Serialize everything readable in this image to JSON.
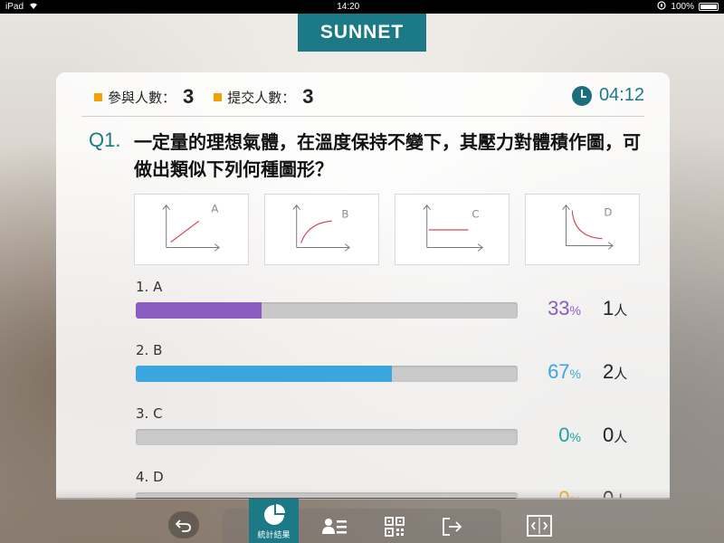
{
  "status_bar": {
    "device": "iPad",
    "time": "14:20",
    "battery": "100%"
  },
  "logo": {
    "text": "SUNNET"
  },
  "header": {
    "participants_label": "參與人數：",
    "participants_value": "3",
    "submitted_label": "提交人數：",
    "submitted_value": "3",
    "timer": "04:12"
  },
  "question": {
    "number": "Q1.",
    "text": "一定量的理想氣體，在溫度保持不變下，其壓力對體積作圖，可做出類似下列何種圖形？",
    "thumbnails": [
      {
        "letter": "A"
      },
      {
        "letter": "B"
      },
      {
        "letter": "C"
      },
      {
        "letter": "D"
      }
    ]
  },
  "options": [
    {
      "label": "1. A",
      "percent": 33,
      "percent_text": "33",
      "count": "1",
      "color": "#8a5cc2"
    },
    {
      "label": "2. B",
      "percent": 67,
      "percent_text": "67",
      "count": "2",
      "color": "#3aa6dd"
    },
    {
      "label": "3. C",
      "percent": 0,
      "percent_text": "0",
      "count": "0",
      "color": "#1ea3a3"
    },
    {
      "label": "4. D",
      "percent": 0,
      "percent_text": "0",
      "count": "0",
      "color": "#f2a100"
    }
  ],
  "units": {
    "percent": "%",
    "people": "人"
  },
  "toolbar": {
    "active_label": "統計結果",
    "icons": [
      "back-icon",
      "pie-chart-icon",
      "user-list-icon",
      "qr-code-icon",
      "exit-icon",
      "split-view-icon"
    ]
  },
  "colors": {
    "accent": "#1b7a86",
    "bullet": "#f2a100"
  }
}
